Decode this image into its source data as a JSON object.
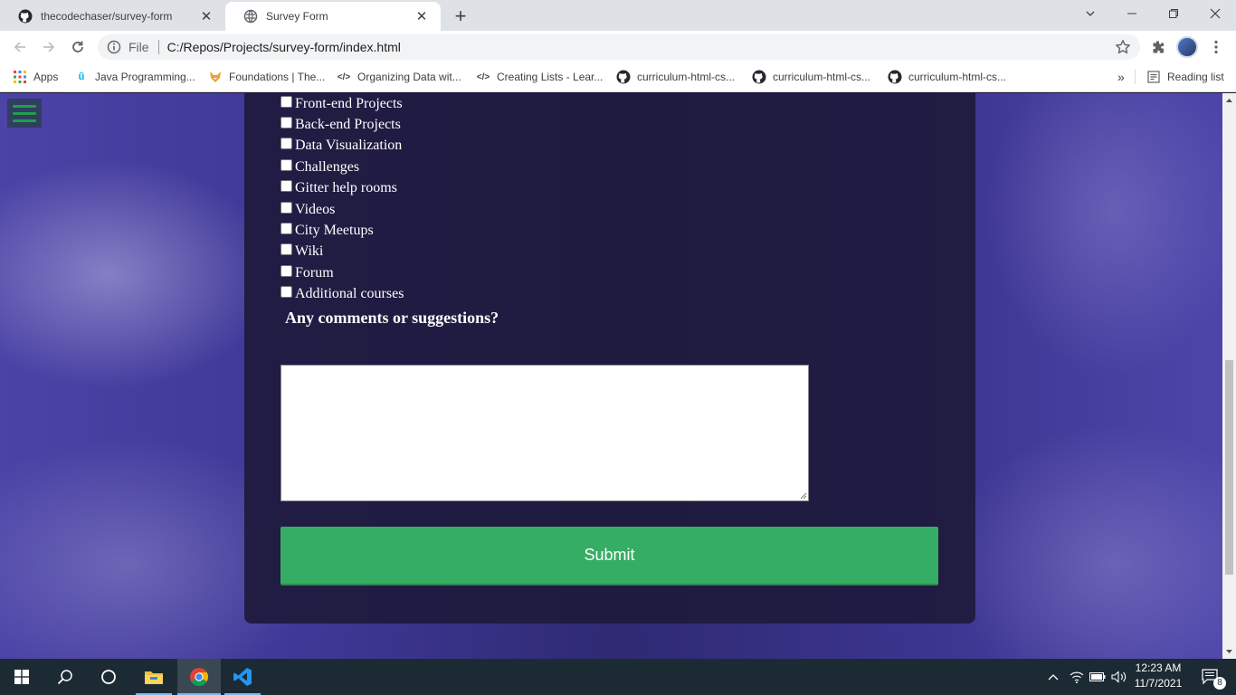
{
  "browser": {
    "tabs": [
      {
        "title": "thecodechaser/survey-form",
        "icon": "github-icon",
        "active": false
      },
      {
        "title": "Survey Form",
        "icon": "globe-icon",
        "active": true
      }
    ],
    "address": {
      "scheme": "File",
      "url": "C:/Repos/Projects/survey-form/index.html"
    },
    "bookmarks": [
      {
        "label": "Apps",
        "icon": "apps-grid-icon"
      },
      {
        "label": "Java Programming...",
        "icon": "udacity-icon"
      },
      {
        "label": "Foundations | The...",
        "icon": "fox-icon"
      },
      {
        "label": "Organizing Data wit...",
        "icon": "code-icon"
      },
      {
        "label": "Creating Lists - Lear...",
        "icon": "code-icon"
      },
      {
        "label": "curriculum-html-cs...",
        "icon": "github-icon"
      },
      {
        "label": "curriculum-html-cs...",
        "icon": "github-icon"
      },
      {
        "label": "curriculum-html-cs...",
        "icon": "github-icon"
      }
    ],
    "overflow": "»",
    "reading_list": "Reading list"
  },
  "form": {
    "checkboxes": [
      {
        "label": "Front-end Projects",
        "checked": false
      },
      {
        "label": "Back-end Projects",
        "checked": false
      },
      {
        "label": "Data Visualization",
        "checked": false
      },
      {
        "label": "Challenges",
        "checked": false
      },
      {
        "label": "Gitter help rooms",
        "checked": false
      },
      {
        "label": "Videos",
        "checked": false
      },
      {
        "label": "City Meetups",
        "checked": false
      },
      {
        "label": "Wiki",
        "checked": false
      },
      {
        "label": "Forum",
        "checked": false
      },
      {
        "label": "Additional courses",
        "checked": false
      }
    ],
    "comments_label": "Any comments or suggestions?",
    "comments_value": "",
    "submit_label": "Submit"
  },
  "taskbar": {
    "time": "12:23 AM",
    "date": "11/7/2021",
    "notification_count": "8"
  },
  "colors": {
    "submit": "#36ad65",
    "menu_bars": "#1ea04a",
    "card": "#1e1a3c"
  }
}
